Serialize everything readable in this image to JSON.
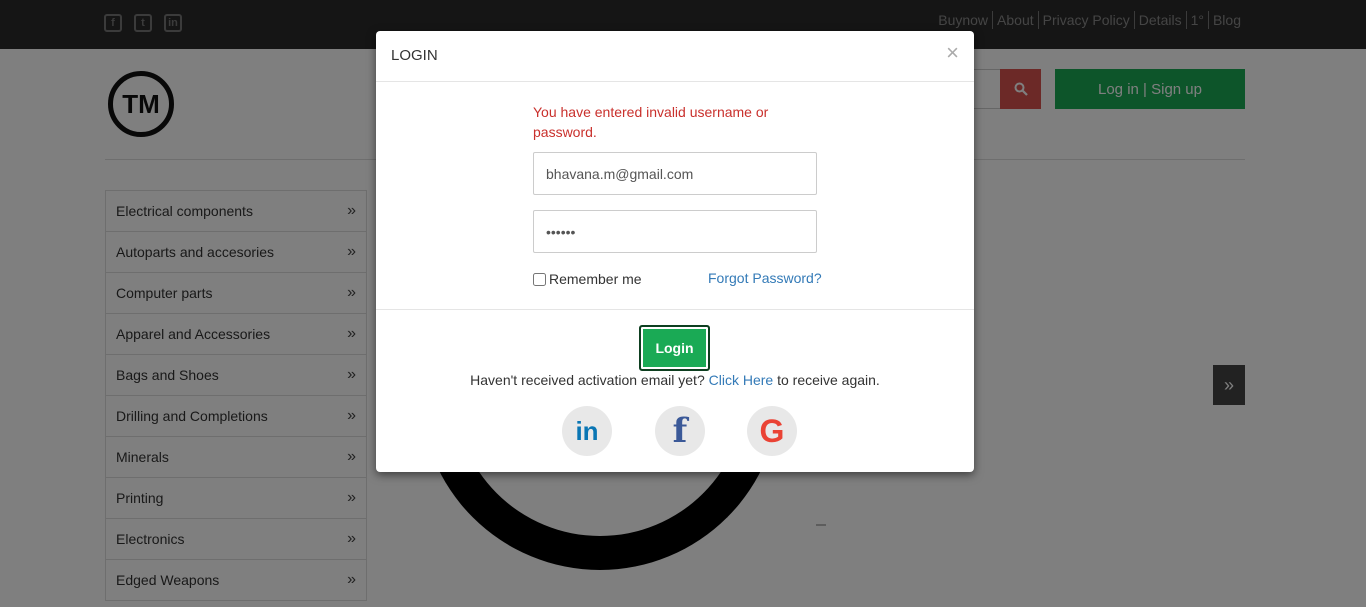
{
  "topbar": {
    "social_icons": [
      "facebook-icon",
      "twitter-icon",
      "linkedin-icon"
    ],
    "links": [
      "Buynow",
      "About",
      "Privacy Policy",
      "Details",
      "1°",
      "Blog"
    ]
  },
  "header": {
    "logo_text": "TM",
    "auth_button": "Log in | Sign up",
    "colors": {
      "search": "#d9534f",
      "auth": "#1aaa55"
    }
  },
  "categories": [
    "Electrical components",
    "Autoparts and accesories",
    "Computer parts",
    "Apparel and Accessories",
    "Bags and Shoes",
    "Drilling and Completions",
    "Minerals",
    "Printing",
    "Electronics",
    "Edged Weapons"
  ],
  "modal": {
    "title": "LOGIN",
    "close_symbol": "×",
    "error": "You have entered invalid username or password.",
    "email_value": "bhavana.m@gmail.com",
    "password_value": "••••••",
    "remember_label": "Remember me",
    "forgot_link": "Forgot Password?",
    "login_button": "Login",
    "activation_text_before": "Haven't received activation email yet?",
    "activation_link": "Click Here",
    "activation_text_after": "to receive again.",
    "social_logins": [
      "linkedin-icon",
      "facebook-icon",
      "google-icon"
    ]
  }
}
